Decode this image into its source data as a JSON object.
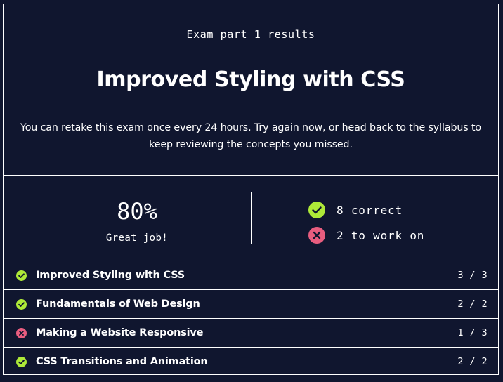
{
  "header": {
    "eyebrow": "Exam part 1 results",
    "title": "Improved Styling with CSS",
    "description": "You can retake this exam once every 24 hours. Try again now, or head back to the syllabus to keep reviewing the concepts you missed."
  },
  "summary": {
    "score": "80%",
    "score_caption": "Great job!",
    "correct_label": "8 correct",
    "incorrect_label": "2 to work on"
  },
  "colors": {
    "background": "#10162f",
    "correct": "#aee938",
    "incorrect": "#e85d7f",
    "text": "#ffffff"
  },
  "icons": {
    "correct": "check-circle-icon",
    "incorrect": "x-circle-icon"
  },
  "topics": [
    {
      "name": "Improved Styling with CSS",
      "score": "3 / 3",
      "status": "correct"
    },
    {
      "name": "Fundamentals of Web Design",
      "score": "2 / 2",
      "status": "correct"
    },
    {
      "name": "Making a Website Responsive",
      "score": "1 / 3",
      "status": "incorrect"
    },
    {
      "name": "CSS Transitions and Animation",
      "score": "2 / 2",
      "status": "correct"
    }
  ]
}
